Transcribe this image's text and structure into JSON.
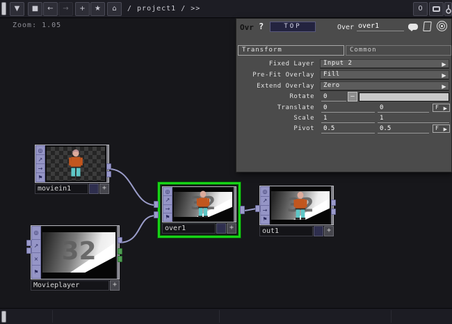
{
  "topbar": {
    "breadcrumb": "/ project1 / >>",
    "counter": "0"
  },
  "icons": {
    "dropdown": "▼",
    "stop": "■",
    "back": "←",
    "forward": "→",
    "add": "+",
    "star": "★",
    "home": "⌂",
    "viewer": "◎",
    "display": "↗",
    "render": "→",
    "cross": "×",
    "bypass": "⚑",
    "plus": "+",
    "menu_arrow": "▶",
    "slider_handle": "–"
  },
  "network": {
    "zoom_label": "Zoom: 1.05",
    "slate_text": "32",
    "nodes": [
      {
        "name": "moviein1",
        "selected": false
      },
      {
        "name": "Movieplayer",
        "selected": false
      },
      {
        "name": "over1",
        "selected": true
      },
      {
        "name": "out1",
        "selected": false
      }
    ]
  },
  "params": {
    "type_abbr": "Ovr",
    "help_label": "?",
    "family": "TOP",
    "op_label": "Over",
    "op_name": "over1",
    "f_label": "F",
    "tabs": [
      "Transform",
      "Common"
    ],
    "rows": [
      {
        "label": "Fixed Layer",
        "type": "menu",
        "value": "Input 2"
      },
      {
        "label": "Pre-Fit Overlay",
        "type": "menu",
        "value": "Fill"
      },
      {
        "label": "Extend Overlay",
        "type": "menu",
        "value": "Zero"
      },
      {
        "label": "Rotate",
        "type": "slider",
        "value": "0"
      },
      {
        "label": "Translate",
        "type": "pair",
        "v1": "0",
        "v2": "0",
        "f": true
      },
      {
        "label": "Scale",
        "type": "pair",
        "v1": "1",
        "v2": "1",
        "f": false
      },
      {
        "label": "Pivot",
        "type": "pair",
        "v1": "0.5",
        "v2": "0.5",
        "f": true
      }
    ]
  },
  "colors": {
    "selection_green": "#17d417",
    "wire": "#9a9cc9",
    "connector_purple": "#9b9bcb",
    "connector_green": "#4f9e53",
    "family_button": "#23233f",
    "panel_bg": "#4b4b4b",
    "network_bg": "#17171b"
  }
}
